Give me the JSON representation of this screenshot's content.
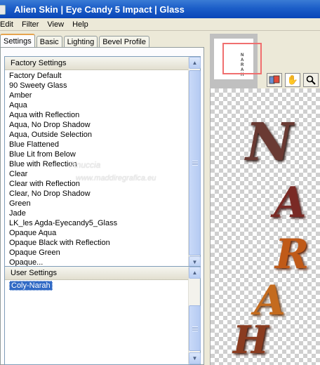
{
  "window": {
    "title": "Alien Skin | Eye Candy 5 Impact | Glass"
  },
  "menu": [
    "Edit",
    "Filter",
    "View",
    "Help"
  ],
  "tabs": [
    "Settings",
    "Basic",
    "Lighting",
    "Bevel Profile"
  ],
  "factory_settings": {
    "header": "Factory Settings",
    "items": [
      "Factory Default",
      "90 Sweety Glass",
      "Amber",
      "Aqua",
      "Aqua with Reflection",
      "Aqua, No Drop Shadow",
      "Aqua, Outside Selection",
      "Blue Flattened",
      "Blue Lit from Below",
      "Blue with Reflection",
      "Clear",
      "Clear with Reflection",
      "Clear, No Drop Shadow",
      "Green",
      "Jade",
      "LK_les Agda-Eyecandy5_Glass",
      "Opaque Aqua",
      "Opaque Black with Reflection",
      "Opaque Green",
      "Opaque..."
    ]
  },
  "user_settings": {
    "header": "User Settings",
    "items": [
      "Coly-Narah"
    ],
    "selected": "Coly-Narah"
  },
  "watermark": {
    "line1": "Pinuccia",
    "line2": "www.maddiregrafica.eu"
  },
  "preview_letters": [
    "N",
    "A",
    "R",
    "A",
    "H"
  ],
  "navigator_letters": "N\nA\nR\nA\nH",
  "colors": {
    "titlebar": "#0a46b8",
    "selection": "#316ac5",
    "nav_rect": "#f06f6f"
  }
}
